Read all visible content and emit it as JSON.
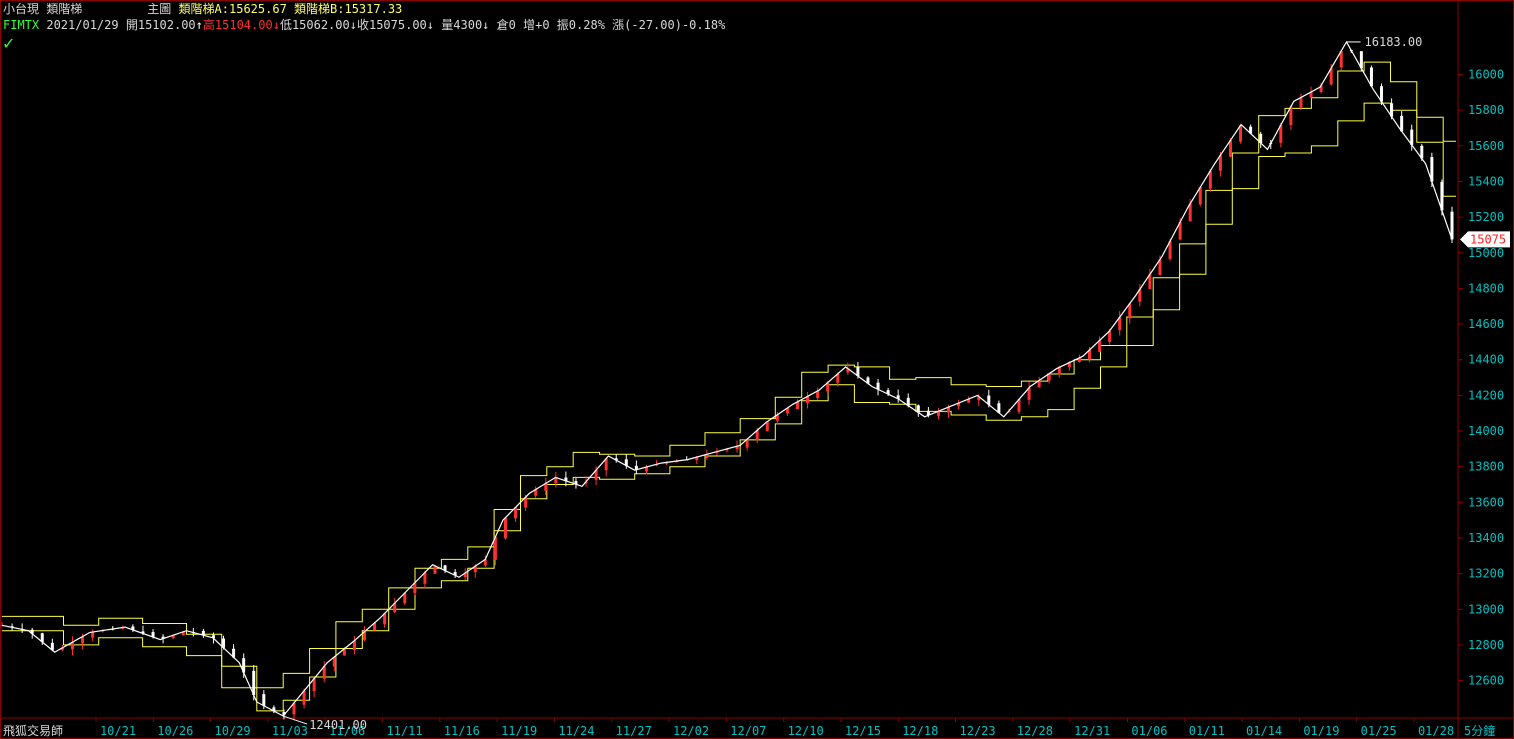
{
  "header": {
    "product": "小台現",
    "indicator_name": "類階梯",
    "panel": "主圖",
    "ind_a": "類階梯A:15625.67",
    "ind_b": "類階梯B:15317.33",
    "symbol": "FIMTX",
    "date": "2021/01/29",
    "open": "開15102.00",
    "open_arrow": "↑",
    "high": "高15104.00",
    "high_arrow": "↓",
    "low": "低15062.00",
    "low_arrow": "↓",
    "close": "收15075.00",
    "close_arrow": "↓",
    "volume": "量4300",
    "volume_arrow": "↓",
    "oi": "倉0",
    "oi_change": "增+0",
    "amplitude": "振0.28%",
    "change": "漲(-27.00)-0.18%"
  },
  "footer": {
    "brand": "飛狐交易師",
    "interval": "5分鐘"
  },
  "chart_data": {
    "type": "candlestick",
    "x_ticks": [
      "10/21",
      "10/26",
      "10/29",
      "11/03",
      "11/06",
      "11/11",
      "11/16",
      "11/19",
      "11/24",
      "11/27",
      "12/02",
      "12/07",
      "12/10",
      "12/15",
      "12/18",
      "12/23",
      "12/28",
      "12/31",
      "01/06",
      "01/11",
      "01/14",
      "01/19",
      "01/25",
      "01/28"
    ],
    "y_ticks": [
      12600,
      12800,
      13000,
      13200,
      13400,
      13600,
      13800,
      14000,
      14200,
      14400,
      14600,
      14800,
      15000,
      15200,
      15400,
      15600,
      15800,
      16000
    ],
    "ylim": [
      12390,
      16250
    ],
    "n_points": 145,
    "close_path": [
      [
        0,
        12910
      ],
      [
        3,
        12880
      ],
      [
        6,
        12760
      ],
      [
        10,
        12870
      ],
      [
        14,
        12900
      ],
      [
        18,
        12830
      ],
      [
        21,
        12880
      ],
      [
        24,
        12840
      ],
      [
        27,
        12700
      ],
      [
        29,
        12480
      ],
      [
        32,
        12401
      ],
      [
        34,
        12520
      ],
      [
        37,
        12700
      ],
      [
        40,
        12820
      ],
      [
        43,
        12950
      ],
      [
        46,
        13100
      ],
      [
        49,
        13250
      ],
      [
        52,
        13180
      ],
      [
        55,
        13280
      ],
      [
        57,
        13500
      ],
      [
        60,
        13650
      ],
      [
        63,
        13740
      ],
      [
        66,
        13690
      ],
      [
        69,
        13860
      ],
      [
        72,
        13780
      ],
      [
        75,
        13820
      ],
      [
        78,
        13840
      ],
      [
        81,
        13880
      ],
      [
        84,
        13920
      ],
      [
        87,
        14050
      ],
      [
        90,
        14150
      ],
      [
        93,
        14230
      ],
      [
        96,
        14360
      ],
      [
        99,
        14250
      ],
      [
        102,
        14180
      ],
      [
        105,
        14080
      ],
      [
        108,
        14140
      ],
      [
        111,
        14200
      ],
      [
        114,
        14080
      ],
      [
        117,
        14250
      ],
      [
        120,
        14350
      ],
      [
        123,
        14420
      ],
      [
        126,
        14560
      ],
      [
        129,
        14760
      ],
      [
        132,
        14980
      ],
      [
        135,
        15260
      ],
      [
        138,
        15500
      ],
      [
        141,
        15720
      ],
      [
        144,
        15580
      ],
      [
        147,
        15850
      ],
      [
        150,
        15930
      ],
      [
        153,
        16183
      ],
      [
        156,
        15920
      ],
      [
        159,
        15700
      ],
      [
        162,
        15500
      ],
      [
        165,
        15075
      ]
    ],
    "highlights": [
      {
        "label": "16183.00",
        "value": 16183,
        "at": 153
      },
      {
        "label": "12401.00",
        "value": 12401,
        "at": 32
      }
    ],
    "last_price": "15075",
    "series": [
      {
        "name": "類階梯A",
        "color": "#ffff44",
        "steps": [
          [
            0,
            12960
          ],
          [
            7,
            12910
          ],
          [
            11,
            12950
          ],
          [
            16,
            12920
          ],
          [
            21,
            12860
          ],
          [
            25,
            12680
          ],
          [
            29,
            12560
          ],
          [
            32,
            12640
          ],
          [
            35,
            12780
          ],
          [
            38,
            12930
          ],
          [
            41,
            13000
          ],
          [
            44,
            13120
          ],
          [
            47,
            13230
          ],
          [
            50,
            13280
          ],
          [
            53,
            13350
          ],
          [
            56,
            13560
          ],
          [
            59,
            13750
          ],
          [
            62,
            13800
          ],
          [
            65,
            13880
          ],
          [
            68,
            13870
          ],
          [
            72,
            13860
          ],
          [
            76,
            13920
          ],
          [
            80,
            13990
          ],
          [
            84,
            14070
          ],
          [
            88,
            14190
          ],
          [
            91,
            14330
          ],
          [
            94,
            14370
          ],
          [
            97,
            14360
          ],
          [
            101,
            14290
          ],
          [
            104,
            14300
          ],
          [
            108,
            14260
          ],
          [
            112,
            14250
          ],
          [
            116,
            14280
          ],
          [
            119,
            14320
          ],
          [
            122,
            14400
          ],
          [
            125,
            14480
          ],
          [
            128,
            14640
          ],
          [
            131,
            14860
          ],
          [
            134,
            15050
          ],
          [
            137,
            15350
          ],
          [
            140,
            15560
          ],
          [
            143,
            15770
          ],
          [
            146,
            15810
          ],
          [
            149,
            15870
          ],
          [
            152,
            16020
          ],
          [
            155,
            16070
          ],
          [
            158,
            15960
          ],
          [
            161,
            15760
          ],
          [
            164,
            15625.67
          ]
        ]
      },
      {
        "name": "類階梯B",
        "color": "#ffff44",
        "steps": [
          [
            0,
            12880
          ],
          [
            7,
            12800
          ],
          [
            11,
            12840
          ],
          [
            16,
            12790
          ],
          [
            21,
            12740
          ],
          [
            25,
            12560
          ],
          [
            29,
            12430
          ],
          [
            32,
            12490
          ],
          [
            35,
            12620
          ],
          [
            38,
            12780
          ],
          [
            41,
            12880
          ],
          [
            44,
            13000
          ],
          [
            47,
            13120
          ],
          [
            50,
            13160
          ],
          [
            53,
            13230
          ],
          [
            56,
            13440
          ],
          [
            59,
            13620
          ],
          [
            62,
            13700
          ],
          [
            65,
            13740
          ],
          [
            68,
            13730
          ],
          [
            72,
            13760
          ],
          [
            76,
            13800
          ],
          [
            80,
            13860
          ],
          [
            84,
            13950
          ],
          [
            88,
            14040
          ],
          [
            91,
            14170
          ],
          [
            94,
            14260
          ],
          [
            97,
            14160
          ],
          [
            101,
            14150
          ],
          [
            104,
            14110
          ],
          [
            108,
            14090
          ],
          [
            112,
            14060
          ],
          [
            116,
            14080
          ],
          [
            119,
            14120
          ],
          [
            122,
            14240
          ],
          [
            125,
            14360
          ],
          [
            128,
            14480
          ],
          [
            131,
            14680
          ],
          [
            134,
            14880
          ],
          [
            137,
            15160
          ],
          [
            140,
            15360
          ],
          [
            143,
            15540
          ],
          [
            146,
            15560
          ],
          [
            149,
            15600
          ],
          [
            152,
            15740
          ],
          [
            155,
            15840
          ],
          [
            158,
            15800
          ],
          [
            161,
            15620
          ],
          [
            164,
            15317.33
          ]
        ]
      }
    ],
    "colors": {
      "up": "#ff3030",
      "down": "#ffffff",
      "axis": "#8b0000",
      "tick_text": "#00c0c0",
      "ladder": "#ffff44"
    }
  }
}
